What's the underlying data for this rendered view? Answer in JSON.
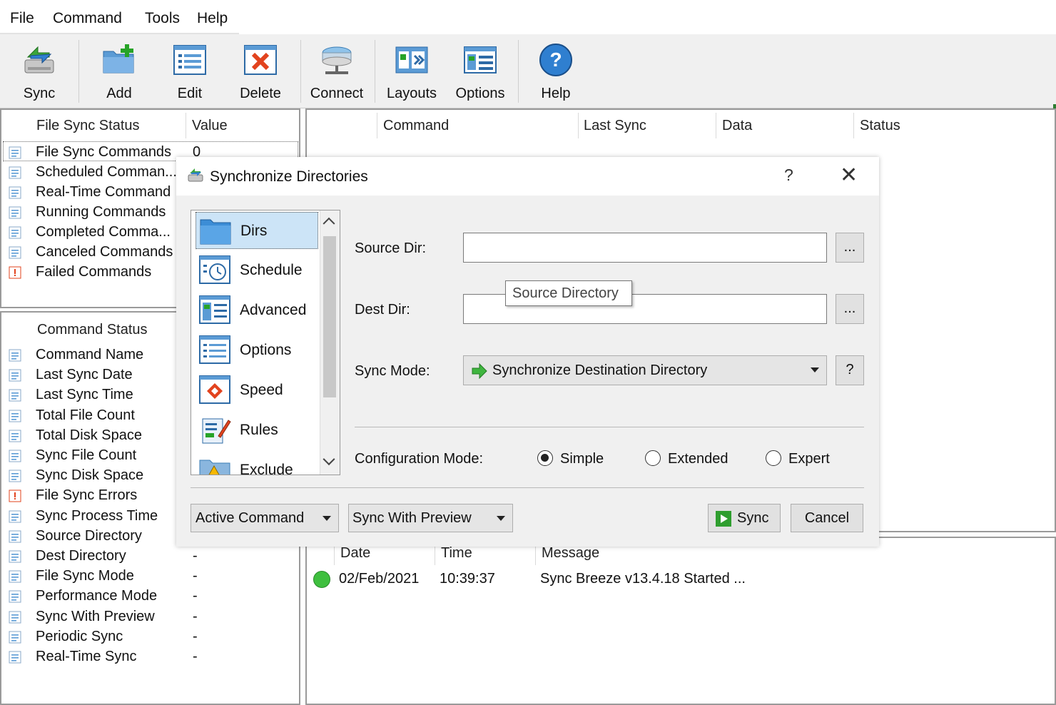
{
  "menu": {
    "file": "File",
    "command": "Command",
    "tools": "Tools",
    "help": "Help"
  },
  "toolbar": {
    "sync": "Sync",
    "add": "Add",
    "edit": "Edit",
    "delete": "Delete",
    "connect": "Connect",
    "layouts": "Layouts",
    "options": "Options",
    "help": "Help"
  },
  "status_panel": {
    "col_status": "File Sync Status",
    "col_value": "Value",
    "rows": [
      {
        "label": "File Sync Commands",
        "value": "0"
      },
      {
        "label": "Scheduled Comman...",
        "value": ""
      },
      {
        "label": "Real-Time Command",
        "value": ""
      },
      {
        "label": "Running Commands",
        "value": ""
      },
      {
        "label": "Completed Comma...",
        "value": ""
      },
      {
        "label": "Canceled Commands",
        "value": ""
      },
      {
        "label": "Failed Commands",
        "value": ""
      }
    ]
  },
  "command_panel": {
    "col_status": "Command Status",
    "rows": [
      {
        "label": "Command Name",
        "value": ""
      },
      {
        "label": "Last Sync Date",
        "value": ""
      },
      {
        "label": "Last Sync Time",
        "value": ""
      },
      {
        "label": "Total File Count",
        "value": ""
      },
      {
        "label": "Total Disk Space",
        "value": ""
      },
      {
        "label": "Sync File Count",
        "value": ""
      },
      {
        "label": "Sync Disk Space",
        "value": ""
      },
      {
        "label": "File Sync Errors",
        "value": ""
      },
      {
        "label": "Sync Process Time",
        "value": ""
      },
      {
        "label": "Source Directory",
        "value": ""
      },
      {
        "label": "Dest Directory",
        "value": "-"
      },
      {
        "label": "File Sync Mode",
        "value": "-"
      },
      {
        "label": "Performance Mode",
        "value": "-"
      },
      {
        "label": "Sync With Preview",
        "value": "-"
      },
      {
        "label": "Periodic Sync",
        "value": "-"
      },
      {
        "label": "Real-Time Sync",
        "value": "-"
      }
    ]
  },
  "commands_table": {
    "col_command": "Command",
    "col_last_sync": "Last Sync",
    "col_data": "Data",
    "col_status": "Status"
  },
  "log": {
    "col_date": "Date",
    "col_time": "Time",
    "col_message": "Message",
    "rows": [
      {
        "date": "02/Feb/2021",
        "time": "10:39:37",
        "message": "Sync Breeze v13.4.18 Started ...",
        "status_color": "#3fbf3f"
      }
    ]
  },
  "dialog": {
    "title": "Synchronize Directories",
    "help_glyph": "?",
    "close_glyph": "✕",
    "nav": [
      "Dirs",
      "Schedule",
      "Advanced",
      "Options",
      "Speed",
      "Rules",
      "Exclude"
    ],
    "source_label": "Source Dir:",
    "source_value": "",
    "dest_label": "Dest Dir:",
    "dest_value": "",
    "browse_label": "...",
    "tooltip": "Source Directory",
    "sync_mode_label": "Sync Mode:",
    "sync_mode_value": "Synchronize Destination Directory",
    "sync_mode_help": "?",
    "config_mode_label": "Configuration Mode:",
    "config_modes": [
      "Simple",
      "Extended",
      "Expert"
    ],
    "config_selected": "Simple",
    "active_command": "Active Command",
    "preview_mode": "Sync With Preview",
    "sync_button": "Sync",
    "cancel_button": "Cancel"
  }
}
